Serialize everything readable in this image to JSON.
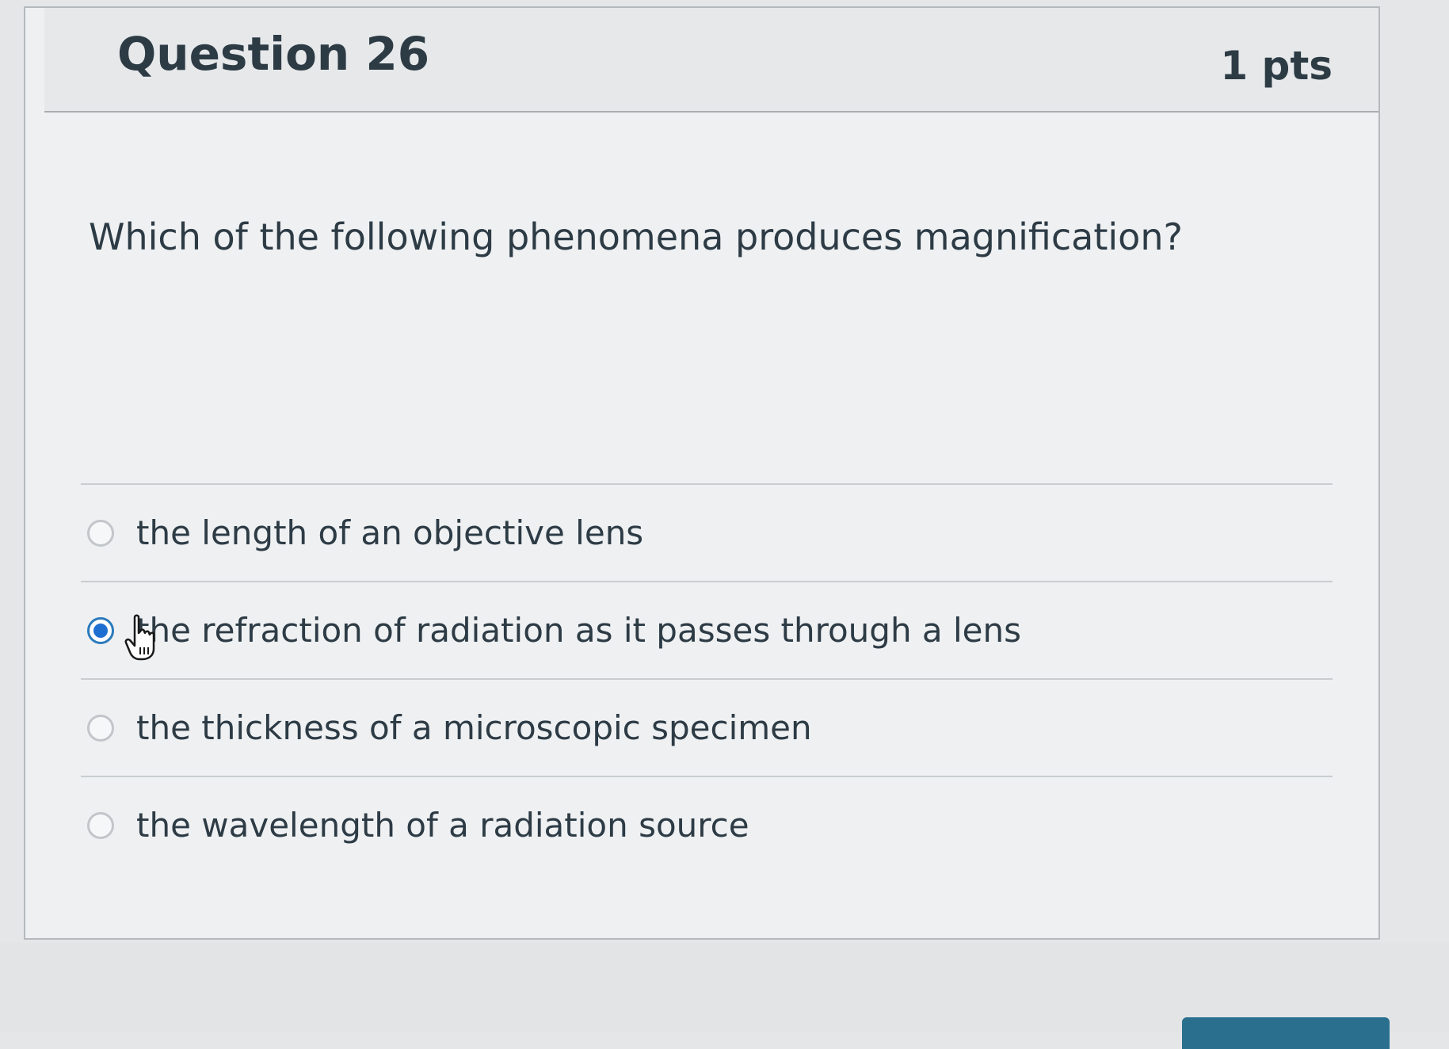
{
  "question": {
    "title": "Question 26",
    "points": "1 pts",
    "text": "Which of the following phenomena produces magnification?"
  },
  "answers": [
    {
      "label": "the length of an objective lens",
      "selected": false
    },
    {
      "label": "the refraction of radiation as it passes through a lens",
      "selected": true
    },
    {
      "label": "the thickness of a microscopic specimen",
      "selected": false
    },
    {
      "label": "the wavelength of a radiation source",
      "selected": false
    }
  ],
  "icons": {
    "cursor": "hand-pointer-icon"
  },
  "colors": {
    "accent": "#1f6fd1",
    "text": "#2d3b45",
    "card_background": "#eef0f2",
    "button": "#2b6f8e"
  }
}
